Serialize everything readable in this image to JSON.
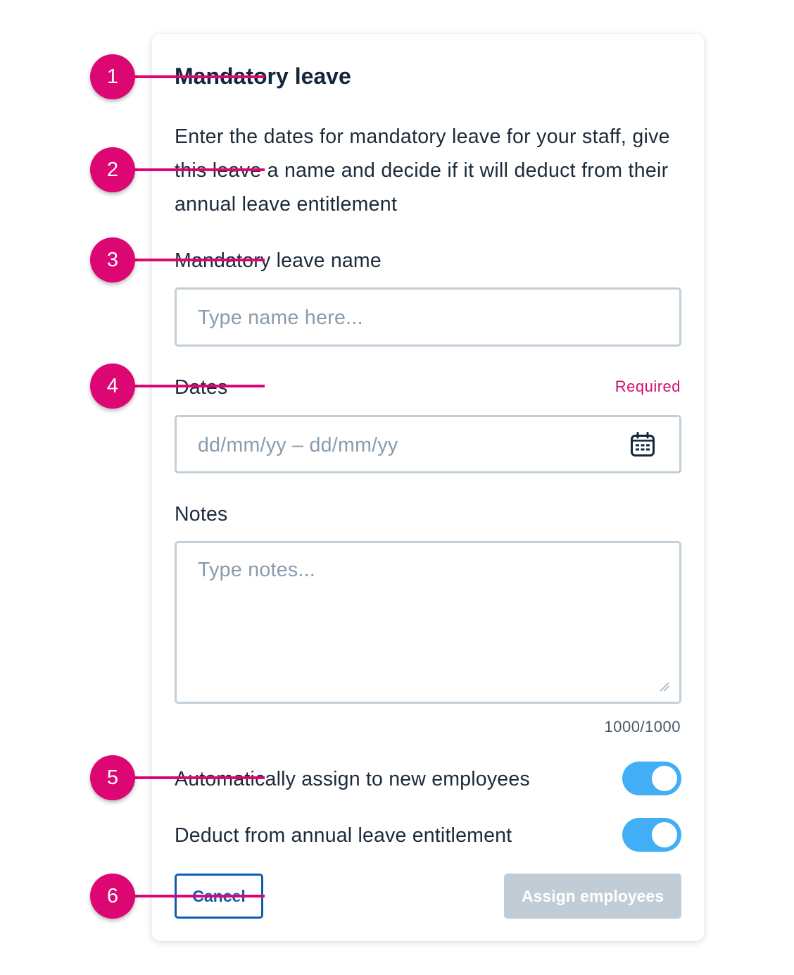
{
  "dialog": {
    "title": "Mandatory leave",
    "description": "Enter the dates for mandatory leave for your staff, give this leave a name and decide if it will deduct from their annual leave entitlement"
  },
  "form": {
    "name": {
      "label": "Mandatory leave name",
      "value": "",
      "placeholder": "Type name here..."
    },
    "dates": {
      "label": "Dates",
      "required_text": "Required",
      "value": "",
      "placeholder": "dd/mm/yy – dd/mm/yy",
      "icon": "calendar-icon"
    },
    "notes": {
      "label": "Notes",
      "value": "",
      "placeholder": "Type notes...",
      "counter": "1000/1000"
    },
    "toggles": [
      {
        "label": "Automatically assign to new employees",
        "on": true
      },
      {
        "label": "Deduct from annual leave entitlement",
        "on": true
      }
    ]
  },
  "actions": {
    "cancel_label": "Cancel",
    "assign_label": "Assign employees",
    "assign_enabled": false
  },
  "annotations": [
    "1",
    "2",
    "3",
    "4",
    "5",
    "6"
  ],
  "colors": {
    "annotation": "#dc0773",
    "toggle_on": "#42aef5",
    "primary": "#0c5fb0",
    "required": "#d1106e",
    "disabled_button": "#c1cdd6"
  }
}
